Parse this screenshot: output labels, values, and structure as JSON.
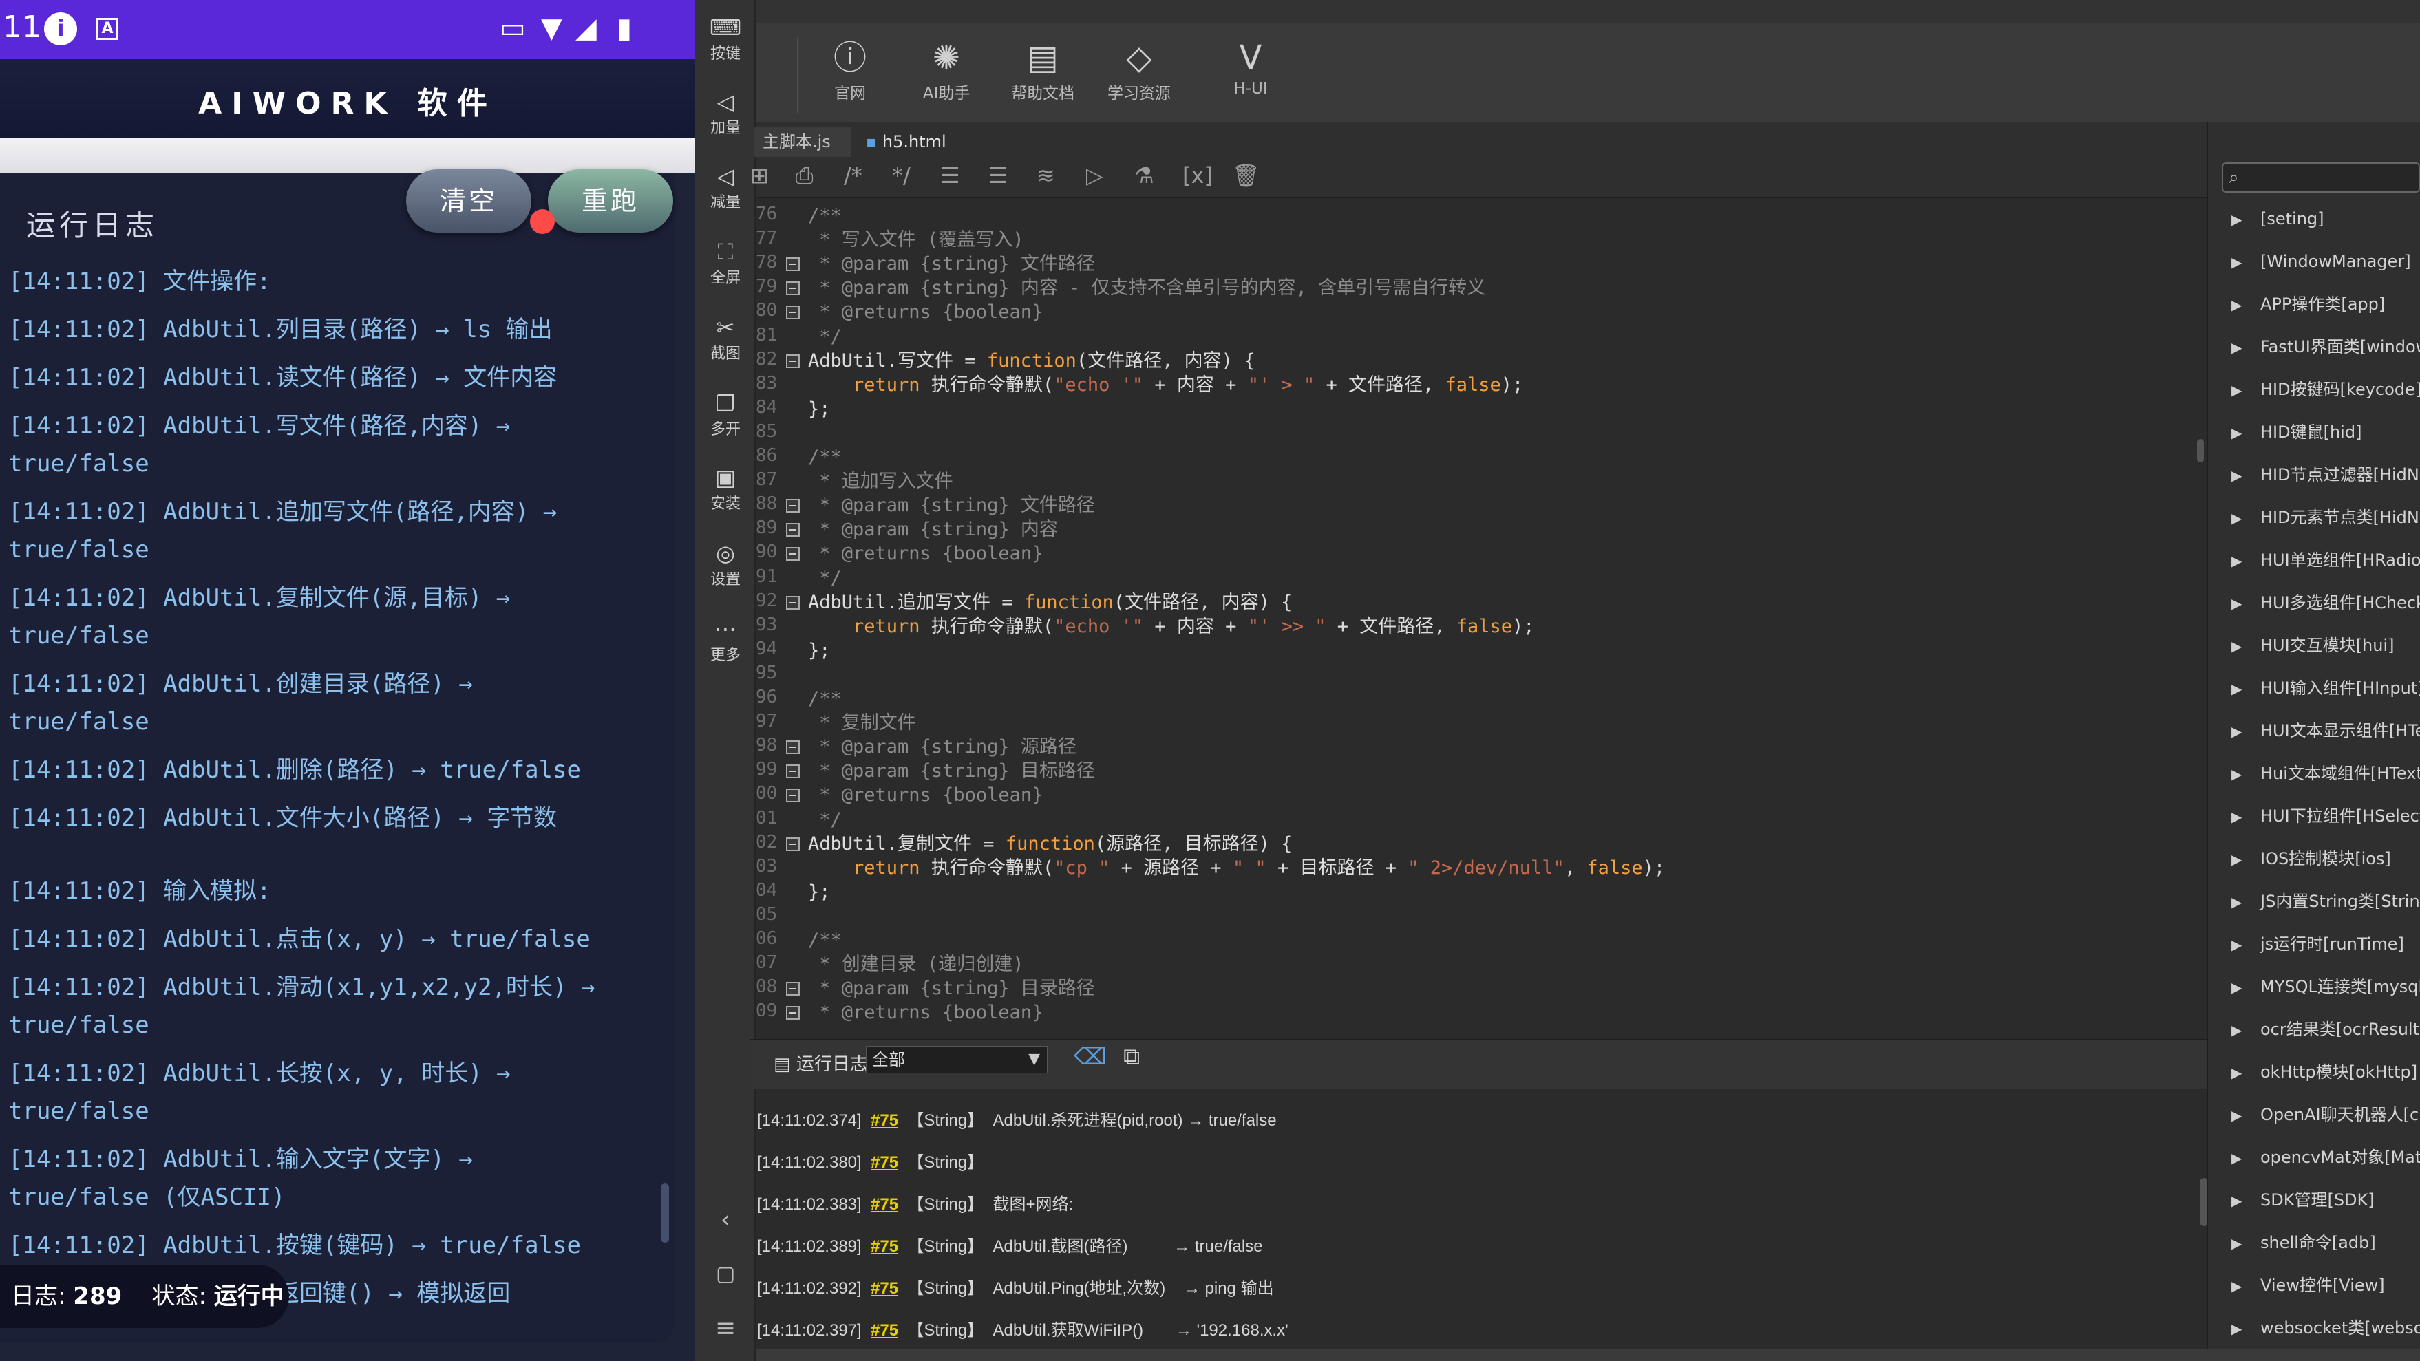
{
  "phone": {
    "status": {
      "time": "11",
      "info_icon": "info-icon",
      "keyboard_badge": "A",
      "icons": [
        "cast-icon",
        "wifi-icon",
        "signal-icon",
        "battery-icon"
      ]
    },
    "app_title": "AIWORK 软件",
    "log_title": "运行日志",
    "buttons": {
      "clear": "清空",
      "rerun": "重跑"
    },
    "log_lines": [
      "[14:11:02] 文件操作:",
      "[14:11:02] AdbUtil.列目录(路径) → ls 输出",
      "[14:11:02] AdbUtil.读文件(路径) → 文件内容",
      "[14:11:02] AdbUtil.写文件(路径,内容) →\ntrue/false",
      "[14:11:02] AdbUtil.追加写文件(路径,内容) →\ntrue/false",
      "[14:11:02] AdbUtil.复制文件(源,目标) →\ntrue/false",
      "[14:11:02] AdbUtil.创建目录(路径) →\ntrue/false",
      "[14:11:02] AdbUtil.删除(路径) → true/false",
      "[14:11:02] AdbUtil.文件大小(路径) → 字节数",
      "",
      "[14:11:02] 输入模拟:",
      "[14:11:02] AdbUtil.点击(x, y) → true/false",
      "[14:11:02] AdbUtil.滑动(x1,y1,x2,y2,时长) →\ntrue/false",
      "[14:11:02] AdbUtil.长按(x, y, 时长) →\ntrue/false",
      "[14:11:02] AdbUtil.输入文字(文字) →\ntrue/false (仅ASCII)",
      "[14:11:02] AdbUtil.按键(键码) → true/false",
      "[14:11:02] AdbUtil.返回键() → 模拟返回"
    ],
    "footer": {
      "count_label": "日志:",
      "count": "289",
      "state_label": "状态:",
      "state": "运行中"
    }
  },
  "left_tools": [
    {
      "icon": "keyboard-icon",
      "label": "按键"
    },
    {
      "icon": "volume-up-icon",
      "label": "加量"
    },
    {
      "icon": "volume-down-icon",
      "label": "减量"
    },
    {
      "icon": "fullscreen-icon",
      "label": "全屏"
    },
    {
      "icon": "scissors-icon",
      "label": "截图"
    },
    {
      "icon": "multi-window-icon",
      "label": "多开"
    },
    {
      "icon": "install-icon",
      "label": "安装"
    },
    {
      "icon": "settings-icon",
      "label": "设置"
    },
    {
      "icon": "more-icon",
      "label": "更多"
    }
  ],
  "top_buttons": [
    {
      "icon": "help-icon",
      "label": "官网"
    },
    {
      "icon": "ai-assistant-icon",
      "label": "AI助手"
    },
    {
      "icon": "docs-icon",
      "label": "帮助文档"
    },
    {
      "icon": "graduation-cap-icon",
      "label": "学习资源"
    },
    {
      "icon": "vue-icon",
      "label": "H-UI"
    }
  ],
  "tabs": [
    {
      "label": "主脚本.js"
    },
    {
      "label": "h5.html"
    }
  ],
  "gutter_lines": [
    "76",
    "77",
    "78",
    "79",
    "80",
    "81",
    "82",
    "83",
    "84",
    "85",
    "86",
    "87",
    "88",
    "89",
    "90",
    "91",
    "92",
    "93",
    "94",
    "95",
    "96",
    "97",
    "98",
    "99",
    "00",
    "01",
    "02",
    "03",
    "04",
    "05",
    "06",
    "07",
    "08",
    "09"
  ],
  "code_lines": [
    "/**",
    " * 写入文件 (覆盖写入)",
    " * @param {string} 文件路径",
    " * @param {string} 内容 - 仅支持不含单引号的内容, 含单引号需自行转义",
    " * @returns {boolean}",
    " */",
    "AdbUtil.写文件 = function(文件路径, 内容) {",
    "    return 执行命令静默(\"echo '\" + 内容 + \"' > \" + 文件路径, false);",
    "};",
    "",
    "/**",
    " * 追加写入文件",
    " * @param {string} 文件路径",
    " * @param {string} 内容",
    " * @returns {boolean}",
    " */",
    "AdbUtil.追加写文件 = function(文件路径, 内容) {",
    "    return 执行命令静默(\"echo '\" + 内容 + \"' >> \" + 文件路径, false);",
    "};",
    "",
    "/**",
    " * 复制文件",
    " * @param {string} 源路径",
    " * @param {string} 目标路径",
    " * @returns {boolean}",
    " */",
    "AdbUtil.复制文件 = function(源路径, 目标路径) {",
    "    return 执行命令静默(\"cp \" + 源路径 + \" \" + 目标路径 + \" 2>/dev/null\", false);",
    "};",
    "",
    "/**",
    " * 创建目录 (递归创建)",
    " * @param {string} 目录路径",
    " * @returns {boolean}"
  ],
  "console": {
    "caption": "运行日志",
    "filter": "全部",
    "entries": [
      {
        "time": "[14:11:02.374]",
        "ref": "#75",
        "type": "【String】",
        "msg": "AdbUtil.杀死进程(pid,root) → true/false"
      },
      {
        "time": "[14:11:02.380]",
        "ref": "#75",
        "type": "【String】",
        "msg": ""
      },
      {
        "time": "[14:11:02.383]",
        "ref": "#75",
        "type": "【String】",
        "msg": "截图+网络:"
      },
      {
        "time": "[14:11:02.389]",
        "ref": "#75",
        "type": "【String】",
        "msg": "AdbUtil.截图(路径)          → true/false"
      },
      {
        "time": "[14:11:02.392]",
        "ref": "#75",
        "type": "【String】",
        "msg": "AdbUtil.Ping(地址,次数)    → ping 输出"
      },
      {
        "time": "[14:11:02.397]",
        "ref": "#75",
        "type": "【String】",
        "msg": "AdbUtil.获取WiFiIP()       → '192.168.x.x'"
      }
    ]
  },
  "right_panel": {
    "items": [
      "[seting]",
      "[WindowManager]",
      "APP操作类[app]",
      "FastUI界面类[window]",
      "HID按键码[keycode]",
      "HID键鼠[hid]",
      "HID节点过滤器[HidNode]",
      "HID元素节点类[HidNode]",
      "HUI单选组件[HRadio]",
      "HUI多选组件[HCheckbox]",
      "HUI交互模块[hui]",
      "HUI输入组件[HInput]",
      "HUI文本显示组件[HText]",
      "Hui文本域组件[HTextarea]",
      "HUI下拉组件[HSelect]",
      "IOS控制模块[ios]",
      "JS内置String类[String]",
      "js运行时[runTime]",
      "MYSQL连接类[mysql]",
      "ocr结果类[ocrResult]",
      "okHttp模块[okHttp]",
      "OpenAI聊天机器人[chat]",
      "opencvMat对象[Mat]",
      "SDK管理[SDK]",
      "shell命令[adb]",
      "View控件[View]",
      "websocket类[websocket]"
    ]
  },
  "colors": {
    "accent": "#5a28d8",
    "log_text": "#8cc1ee",
    "keyword": "#f0a040",
    "string": "#c36b4f",
    "comment": "#8c8c8c",
    "link": "#e6d000"
  }
}
